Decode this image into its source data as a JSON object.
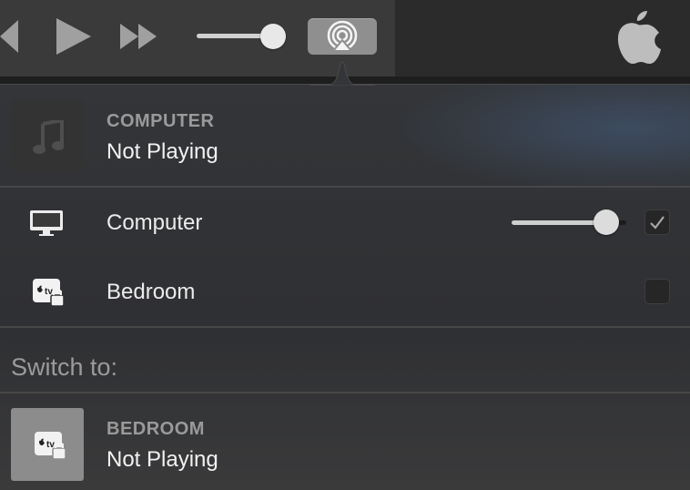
{
  "toolbar": {
    "rewind_icon": "rewind-icon",
    "play_icon": "play-icon",
    "fast_forward_icon": "fast-forward-icon",
    "volume_level": 0.82,
    "airplay_icon": "airplay-icon",
    "apple_logo": "apple-logo-icon"
  },
  "now_playing": {
    "source": "COMPUTER",
    "status": "Not Playing",
    "artwork_icon": "music-note-icon"
  },
  "devices": [
    {
      "label": "Computer",
      "icon": "monitor-icon",
      "checked": true,
      "volume": 0.83
    },
    {
      "label": "Bedroom",
      "icon": "apple-tv-locked-icon",
      "checked": false
    }
  ],
  "switch_section": {
    "title": "Switch to:",
    "items": [
      {
        "source": "BEDROOM",
        "status": "Not Playing",
        "icon": "apple-tv-locked-icon"
      }
    ]
  },
  "colors": {
    "toolbar_bg": "#3a3a3a",
    "popover_bg": "#333538",
    "airplay_button": "#8f8f8f",
    "accent_glow": "#465f82"
  }
}
